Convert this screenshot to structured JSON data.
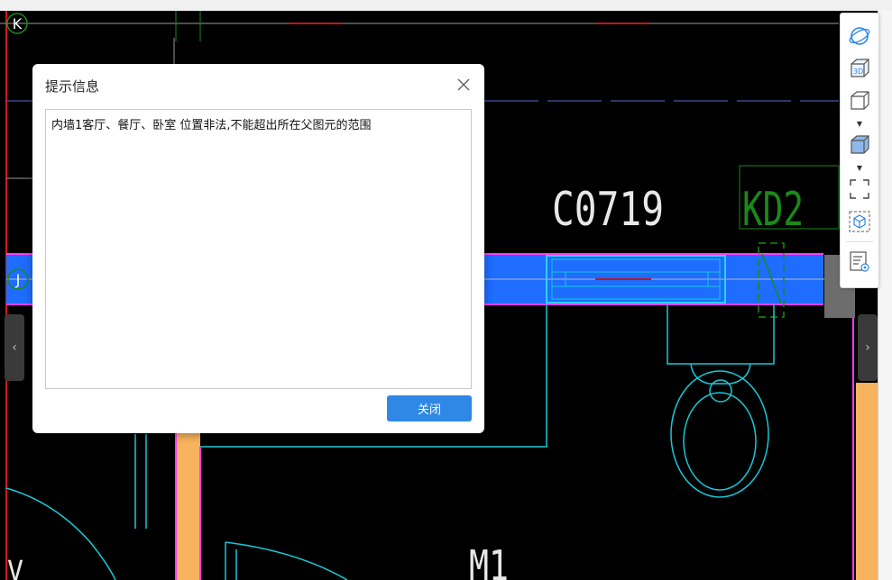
{
  "dialog": {
    "title": "提示信息",
    "message": "内墙1客厅、餐厅、卧室 位置非法,不能超出所在父图元的范围",
    "close_button_label": "关闭"
  },
  "drawing": {
    "axis_k_label": "K",
    "axis_j_label": "J",
    "window_label": "C0719",
    "door_label": "KD2",
    "bottom_label": "M1"
  },
  "toolbar": {
    "items": [
      "orbit-icon",
      "view-3d-icon",
      "view-cube-icon",
      "shaded-cube-icon",
      "fullscreen-icon",
      "isolate-icon",
      "properties-panel-icon"
    ]
  },
  "colors": {
    "wall_blue": "#1e6dff",
    "wall_orange": "#f7b35d",
    "cad_cyan": "#17c8d8",
    "cad_magenta": "#ff39ff",
    "accent_button": "#2f87e6"
  }
}
